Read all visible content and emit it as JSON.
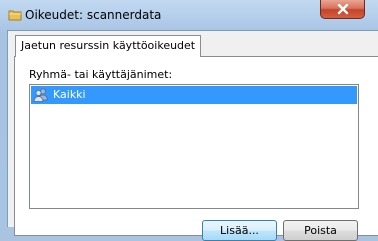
{
  "window": {
    "title": "Oikeudet: scannerdata",
    "icon": "folder-icon",
    "close_icon": "close-icon"
  },
  "tabs": [
    {
      "label": "Jaetun resurssin käyttöoikeudet",
      "selected": true
    }
  ],
  "permissions": {
    "group_label": "Ryhmä- tai käyttäjänimet:",
    "items": [
      {
        "label": "Kaikki",
        "icon": "users-icon",
        "selected": true
      }
    ],
    "add_button": "Lisää...",
    "remove_button": "Poista"
  },
  "colors": {
    "selection": "#3399ff",
    "close_button": "#c4442a"
  }
}
